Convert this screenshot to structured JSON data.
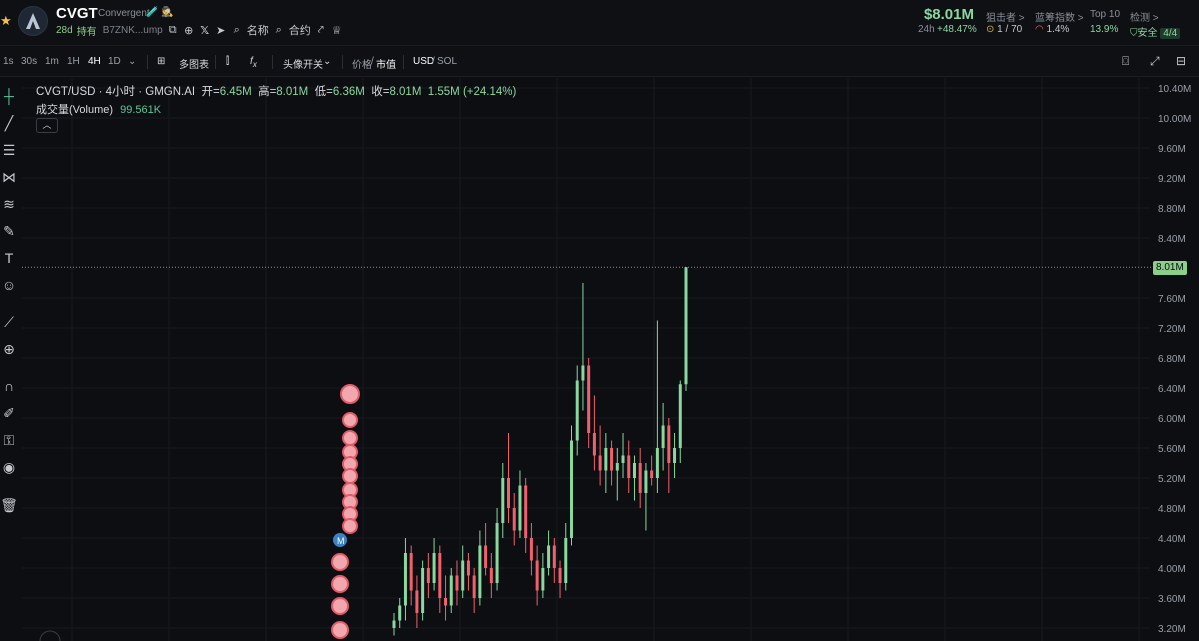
{
  "header": {
    "ticker": "CVGT",
    "name": "Convergent",
    "age": "28d",
    "hold_label": "持有",
    "address": "B7ZNK...ump",
    "name_link": "名称",
    "contract_link": "合约",
    "price": "$8.01M",
    "change_label": "24h",
    "change_value": "+48.47%",
    "stats": [
      {
        "label": "狙击者 >",
        "value": "1 / 70"
      },
      {
        "label": "蓝筹指数 >",
        "value": "1.4%"
      },
      {
        "label": "Top 10",
        "value": "13.9%"
      },
      {
        "label": "检测 >",
        "value": "安全",
        "extra": "4/4"
      }
    ],
    "accent_green": "#88d8a0",
    "accent_red": "#f0616d"
  },
  "toolbar": {
    "intervals": [
      "1s",
      "30s",
      "1m",
      "1H",
      "4H",
      "1D"
    ],
    "active_interval": "4H",
    "multi_chart": "多图表",
    "avatar_toggle": "头像开关",
    "price_label": "价格",
    "mcap_label": "市值",
    "usd_label": "USD",
    "sol_label": "SOL"
  },
  "chart_header": {
    "title": "CVGT/USD · 4小时 · GMGN.AI",
    "open_label": "开",
    "open": "6.45M",
    "high_label": "高",
    "high": "8.01M",
    "low_label": "低",
    "low": "6.36M",
    "close_label": "收",
    "close": "8.01M",
    "change": "1.55M (+24.14%)",
    "volume_label": "成交量(Volume)",
    "volume_value": "99.561K"
  },
  "chart_data": {
    "type": "candlestick",
    "y_ticks": [
      "10.40M",
      "10.00M",
      "9.60M",
      "9.20M",
      "8.80M",
      "8.40M",
      "8.01M",
      "7.60M",
      "7.20M",
      "6.80M",
      "6.40M",
      "6.00M",
      "5.60M",
      "5.20M",
      "4.80M",
      "4.40M",
      "4.00M",
      "3.60M",
      "3.20M"
    ],
    "ylim": [
      3.05,
      10.5
    ],
    "last_price": 8.01,
    "last_price_label": "8.01M",
    "candles": [
      {
        "o": 3.2,
        "h": 3.4,
        "l": 3.1,
        "c": 3.3
      },
      {
        "o": 3.3,
        "h": 3.6,
        "l": 3.2,
        "c": 3.5
      },
      {
        "o": 3.5,
        "h": 4.4,
        "l": 3.3,
        "c": 4.2
      },
      {
        "o": 4.2,
        "h": 4.3,
        "l": 3.5,
        "c": 3.7
      },
      {
        "o": 3.7,
        "h": 3.9,
        "l": 3.2,
        "c": 3.4
      },
      {
        "o": 3.4,
        "h": 4.1,
        "l": 3.3,
        "c": 4.0
      },
      {
        "o": 4.0,
        "h": 4.2,
        "l": 3.6,
        "c": 3.8
      },
      {
        "o": 3.8,
        "h": 4.4,
        "l": 3.7,
        "c": 4.2
      },
      {
        "o": 4.2,
        "h": 4.3,
        "l": 3.4,
        "c": 3.6
      },
      {
        "o": 3.6,
        "h": 3.9,
        "l": 3.3,
        "c": 3.5
      },
      {
        "o": 3.5,
        "h": 4.0,
        "l": 3.4,
        "c": 3.9
      },
      {
        "o": 3.9,
        "h": 4.1,
        "l": 3.5,
        "c": 3.7
      },
      {
        "o": 3.7,
        "h": 4.3,
        "l": 3.6,
        "c": 4.1
      },
      {
        "o": 4.1,
        "h": 4.2,
        "l": 3.7,
        "c": 3.9
      },
      {
        "o": 3.9,
        "h": 4.0,
        "l": 3.4,
        "c": 3.6
      },
      {
        "o": 3.6,
        "h": 4.5,
        "l": 3.5,
        "c": 4.3
      },
      {
        "o": 4.3,
        "h": 4.6,
        "l": 3.9,
        "c": 4.0
      },
      {
        "o": 4.0,
        "h": 4.2,
        "l": 3.6,
        "c": 3.8
      },
      {
        "o": 3.8,
        "h": 4.8,
        "l": 3.7,
        "c": 4.6
      },
      {
        "o": 4.6,
        "h": 5.4,
        "l": 4.4,
        "c": 5.2
      },
      {
        "o": 5.2,
        "h": 5.8,
        "l": 4.6,
        "c": 4.8
      },
      {
        "o": 4.8,
        "h": 5.0,
        "l": 4.3,
        "c": 4.5
      },
      {
        "o": 4.5,
        "h": 5.3,
        "l": 4.4,
        "c": 5.1
      },
      {
        "o": 5.1,
        "h": 5.2,
        "l": 4.2,
        "c": 4.4
      },
      {
        "o": 4.4,
        "h": 4.6,
        "l": 3.9,
        "c": 4.1
      },
      {
        "o": 4.1,
        "h": 4.3,
        "l": 3.5,
        "c": 3.7
      },
      {
        "o": 3.7,
        "h": 4.2,
        "l": 3.6,
        "c": 4.0
      },
      {
        "o": 4.0,
        "h": 4.5,
        "l": 3.9,
        "c": 4.3
      },
      {
        "o": 4.3,
        "h": 4.4,
        "l": 3.8,
        "c": 4.0
      },
      {
        "o": 4.0,
        "h": 4.1,
        "l": 3.6,
        "c": 3.8
      },
      {
        "o": 3.8,
        "h": 4.6,
        "l": 3.7,
        "c": 4.4
      },
      {
        "o": 4.4,
        "h": 5.9,
        "l": 4.3,
        "c": 5.7
      },
      {
        "o": 5.7,
        "h": 6.7,
        "l": 5.5,
        "c": 6.5
      },
      {
        "o": 6.5,
        "h": 7.8,
        "l": 6.1,
        "c": 6.7
      },
      {
        "o": 6.7,
        "h": 6.8,
        "l": 5.6,
        "c": 5.8
      },
      {
        "o": 5.8,
        "h": 6.3,
        "l": 5.3,
        "c": 5.5
      },
      {
        "o": 5.5,
        "h": 5.9,
        "l": 5.1,
        "c": 5.3
      },
      {
        "o": 5.3,
        "h": 5.8,
        "l": 5.0,
        "c": 5.6
      },
      {
        "o": 5.6,
        "h": 5.7,
        "l": 5.1,
        "c": 5.3
      },
      {
        "o": 5.3,
        "h": 5.6,
        "l": 4.9,
        "c": 5.4
      },
      {
        "o": 5.4,
        "h": 5.8,
        "l": 5.2,
        "c": 5.5
      },
      {
        "o": 5.5,
        "h": 5.7,
        "l": 5.0,
        "c": 5.2
      },
      {
        "o": 5.2,
        "h": 5.5,
        "l": 4.9,
        "c": 5.4
      },
      {
        "o": 5.4,
        "h": 5.6,
        "l": 4.8,
        "c": 5.0
      },
      {
        "o": 5.0,
        "h": 5.4,
        "l": 4.5,
        "c": 5.3
      },
      {
        "o": 5.3,
        "h": 5.5,
        "l": 5.1,
        "c": 5.2
      },
      {
        "o": 5.2,
        "h": 7.3,
        "l": 5.0,
        "c": 5.6
      },
      {
        "o": 5.6,
        "h": 6.2,
        "l": 5.3,
        "c": 5.9
      },
      {
        "o": 5.9,
        "h": 6.0,
        "l": 5.0,
        "c": 5.4
      },
      {
        "o": 5.4,
        "h": 5.8,
        "l": 5.2,
        "c": 5.6
      },
      {
        "o": 5.6,
        "h": 6.5,
        "l": 5.4,
        "c": 6.45
      },
      {
        "o": 6.45,
        "h": 8.01,
        "l": 6.36,
        "c": 8.01
      }
    ]
  }
}
